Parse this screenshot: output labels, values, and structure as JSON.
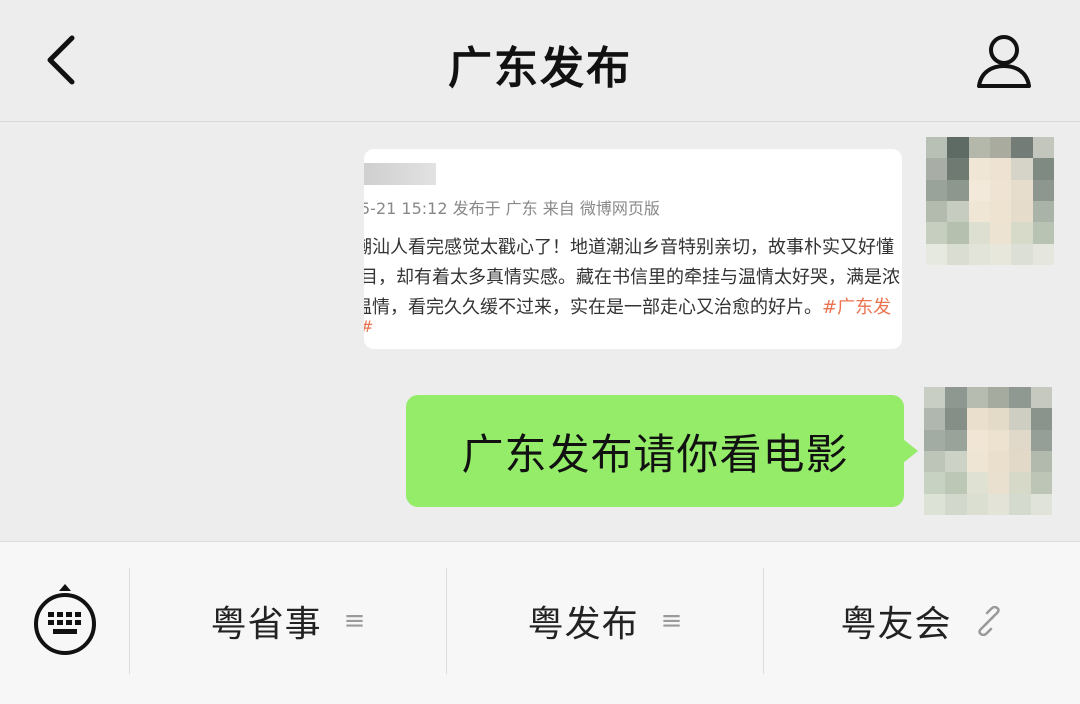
{
  "header": {
    "title": "广东发布",
    "back_icon": "chevron-left-icon",
    "profile_icon": "person-icon"
  },
  "chat": {
    "shared_screenshot": {
      "meta": "5-21 15:12 发布于 广东 来自 微博网页版",
      "lines": [
        "潮汕人看完感觉太戳心了！地道潮汕乡音特别亲切，故事朴实又好懂",
        "目，却有着太多真情实感。藏在书信里的牵挂与温情太好哭，满是浓",
        "温情，看完久久缓不过来，实在是一部走心又治愈的好片。"
      ],
      "hashtag_fragment": "#广东发",
      "hash_tail": "#"
    },
    "message_text": "广东发布请你看电影"
  },
  "menu": {
    "keyboard_icon": "keyboard-icon",
    "items": [
      {
        "label": "粤省事",
        "icon": "menu-list-icon",
        "glyph": "≡"
      },
      {
        "label": "粤发布",
        "icon": "menu-list-icon",
        "glyph": "≡"
      },
      {
        "label": "粤友会",
        "icon": "link-icon",
        "glyph": "🔗"
      }
    ]
  },
  "colors": {
    "background": "#ededed",
    "bubble": "#95ec69",
    "menubar": "#f7f7f7",
    "hashtag": "#eb7350"
  }
}
